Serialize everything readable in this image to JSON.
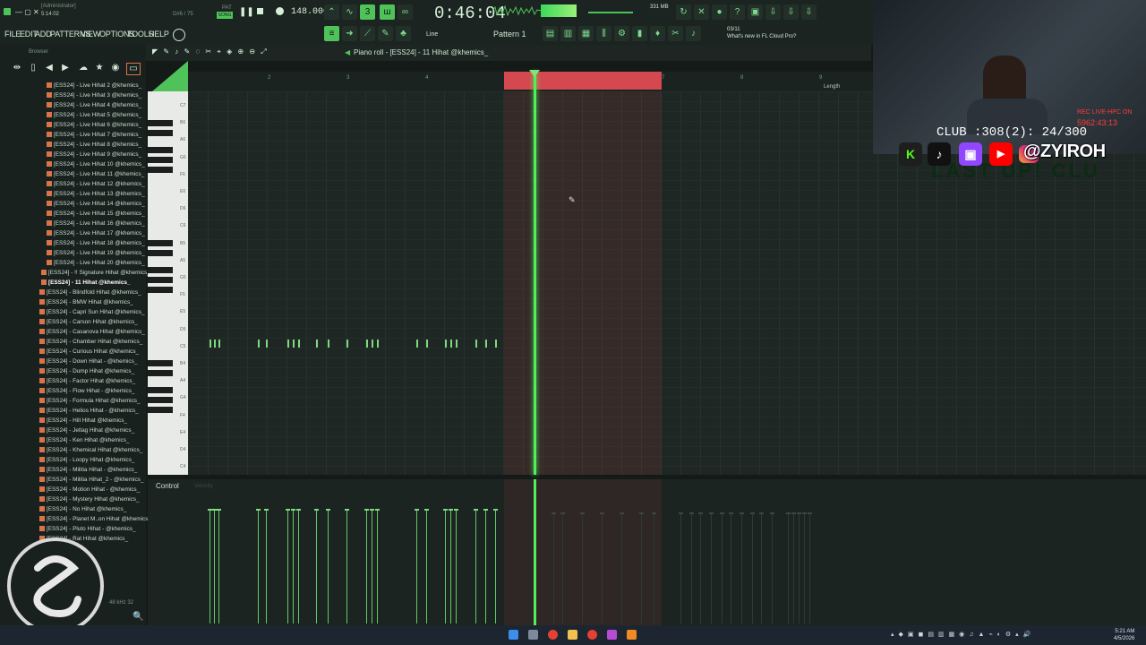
{
  "window": {
    "title": "[Administrator]",
    "time_small": "5:14:02"
  },
  "transport": {
    "pat_label": "PAT",
    "song_label": "SONG",
    "tempo": "148.000",
    "time": "0:46:04",
    "memory": "331 MB",
    "position_small": "D#6 / 75"
  },
  "menu": [
    "FILE",
    "EDIT",
    "ADD",
    "PATTERNS",
    "VIEW",
    "OPTIONS",
    "TOOLS",
    "HELP"
  ],
  "toolbar": {
    "pattern": "Pattern 1",
    "line_label": "Line",
    "news_date": "03/11",
    "news_text": "What's new in FL Cloud Pro?"
  },
  "browser": {
    "title": "Browser",
    "items": [
      "[ESS24] - Live Hihat 2 @khemics_",
      "[ESS24] - Live Hihat 3 @khemics_",
      "[ESS24] - Live Hihat 4 @khemics_",
      "[ESS24] - Live Hihat 5 @khemics_",
      "[ESS24] - Live Hihat 6 @khemics_",
      "[ESS24] - Live Hihat 7 @khemics_",
      "[ESS24] - Live Hihat 8 @khemics_",
      "[ESS24] - Live Hihat 9 @khemics_",
      "[ESS24] - Live Hihat 10 @khemics_",
      "[ESS24] - Live Hihat 11 @khemics_",
      "[ESS24] - Live Hihat 12 @khemics_",
      "[ESS24] - Live Hihat 13 @khemics_",
      "[ESS24] - Live Hihat 14 @khemics_",
      "[ESS24] - Live Hihat 15 @khemics_",
      "[ESS24] - Live Hihat 16 @khemics_",
      "[ESS24] - Live Hihat 17 @khemics_",
      "[ESS24] - Live Hihat 18 @khemics_",
      "[ESS24] - Live Hihat 19 @khemics_",
      "[ESS24] - Live Hihat 20 @khemics_",
      "[ESS24] - !! Signature Hihat @khemics_",
      "[ESS24] - 11 Hihat @khemics_",
      "[ESS24] - Blindfold Hihat @khemics_",
      "[ESS24] - BMW Hihat @khemics_",
      "[ESS24] - Capri Sun Hihat @khemics_",
      "[ESS24] - Carson Hihat @khemics_",
      "[ESS24] - Casanova Hihat @khemics_",
      "[ESS24] - Chamber Hihat @khemics_",
      "[ESS24] - Curious Hihat @khemics_",
      "[ESS24] - Down Hihat - @khemics_",
      "[ESS24] - Dump Hihat @khemics_",
      "[ESS24] - Factor Hihat @khemics_",
      "[ESS24] - Flow Hihat - @khemics_",
      "[ESS24] - Formula Hihat @khemics_",
      "[ESS24] - Helios Hihat - @khemics_",
      "[ESS24] - Hill Hihat @khemics_",
      "[ESS24] - Jetlag Hihat @khemics_",
      "[ESS24] - Ken Hihat @khemics_",
      "[ESS24] - Khemical Hihat @khemics_",
      "[ESS24] - Loopy Hihat @khemics_",
      "[ESS24] - Militia Hihat - @khemics_",
      "[ESS24] - Militia Hihat_2 - @khemics_",
      "[ESS24] - Motion Hihat - @khemics_",
      "[ESS24] - Mystery Hihat @khemics_",
      "[ESS24] - No Hihat @khemics_",
      "[ESS24] - Planet M..on Hihat @khemics_",
      "[ESS24] - Pluto Hihat - @khemics_",
      "[ESS24] - Rat Hihat @khemics_"
    ],
    "selected_index": 20,
    "footer": "48 kHz 32"
  },
  "piano_roll": {
    "title": "Piano roll - [ESS24] - 11 Hihat @khemics_",
    "length_label": "Length",
    "bars": [
      "2",
      "3",
      "4",
      "5",
      "6",
      "7",
      "8",
      "9"
    ],
    "key_labels": [
      "C7",
      "B6",
      "A6",
      "G6",
      "F6",
      "E6",
      "D6",
      "C6",
      "B5",
      "A5",
      "G5",
      "F5",
      "E5",
      "D5",
      "C5",
      "B4",
      "A4",
      "G4",
      "F4",
      "E4",
      "D4",
      "C4"
    ],
    "control_label": "Control",
    "control_sub": "Velocity"
  },
  "overlay": {
    "club": "CLUB :308(2): 24/300",
    "rec": "REC LIVE-HPC ON",
    "rec_time": "5962:43:13",
    "handle": "@ZYIROH",
    "ticker": "LAST UP! CLU"
  },
  "taskbar": {
    "time": "5:21 AM",
    "date": "4/5/2026"
  },
  "colors": {
    "accent": "#4fc35a",
    "loop": "#d4484f",
    "playhead": "#4ff05a"
  }
}
